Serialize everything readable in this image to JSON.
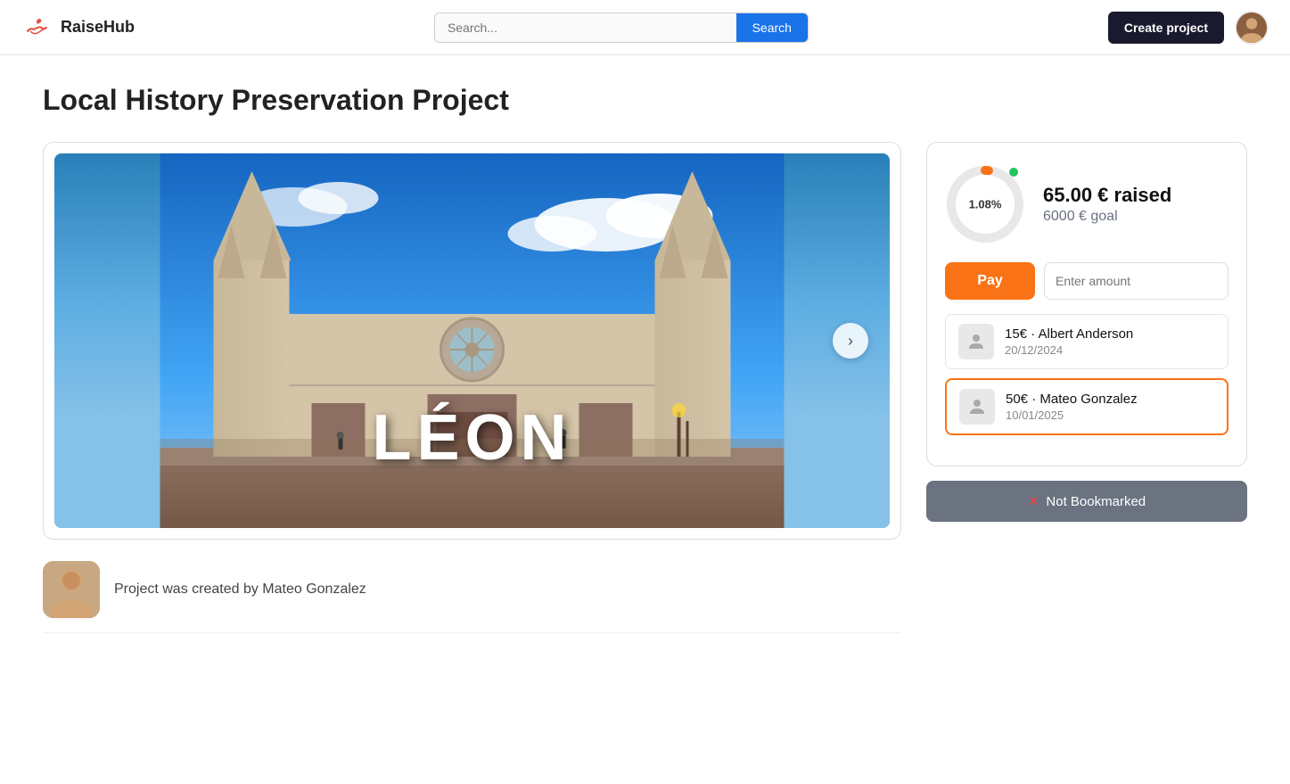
{
  "nav": {
    "logo_text": "RaiseHub",
    "search_placeholder": "Search...",
    "search_btn": "Search",
    "create_btn": "Create project"
  },
  "page": {
    "title": "Local History Preservation Project"
  },
  "image": {
    "city_label": "LÉON",
    "next_btn": "›"
  },
  "creator": {
    "text": "Project was created by Mateo Gonzalez"
  },
  "funding": {
    "percent": "1.08%",
    "raised": "65.00 € raised",
    "goal": "6000 € goal",
    "pay_btn": "Pay",
    "amount_placeholder": "Enter amount",
    "donors": [
      {
        "name": "15€ · Albert Anderson",
        "date": "20/12/2024",
        "highlighted": false
      },
      {
        "name": "50€ · Mateo Gonzalez",
        "date": "10/01/2025",
        "highlighted": true
      }
    ],
    "bookmark_icon": "✕",
    "bookmark_text": "Not Bookmarked"
  }
}
